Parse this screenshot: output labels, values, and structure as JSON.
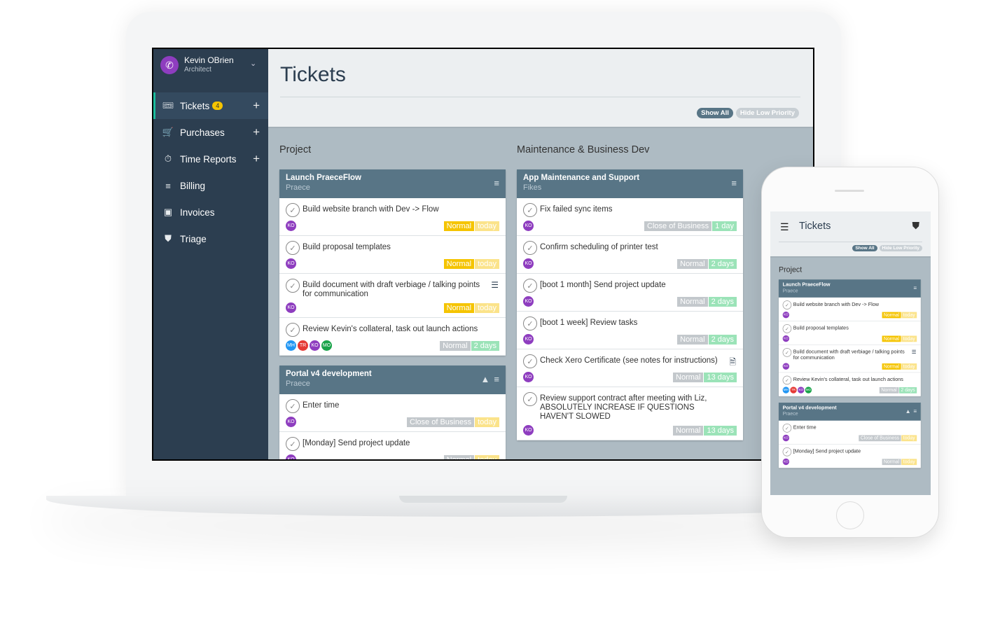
{
  "user": {
    "name": "Kevin OBrien",
    "role": "Architect"
  },
  "sidebar": {
    "items": [
      {
        "label": "Tickets",
        "icon": "ticket-icon",
        "glyph": "🎟",
        "badge": "4",
        "plus": true,
        "active": true
      },
      {
        "label": "Purchases",
        "icon": "cart-icon",
        "glyph": "🛒",
        "plus": true
      },
      {
        "label": "Time Reports",
        "icon": "stopwatch-icon",
        "glyph": "⏱",
        "plus": true
      },
      {
        "label": "Billing",
        "icon": "billing-list-icon",
        "glyph": "≡"
      },
      {
        "label": "Invoices",
        "icon": "inbox-icon",
        "glyph": "▣"
      },
      {
        "label": "Triage",
        "icon": "shield-icon",
        "glyph": "⛊"
      }
    ]
  },
  "header": {
    "title": "Tickets",
    "filters": {
      "show_all": "Show All",
      "hide_low": "Hide Low Priority"
    }
  },
  "colors": {
    "sidebar": "#2c3e50",
    "card_header": "#587586",
    "normal": "#f5c400",
    "today": "#fbe38a",
    "gray": "#c3c8cc",
    "days": "#9be3b8",
    "KO": "#8e3dbf",
    "MH": "#2196f3",
    "TR": "#e53935",
    "MO": "#1aa34a"
  },
  "columns": [
    {
      "title": "Project",
      "cards": [
        {
          "title": "Launch PraeceFlow",
          "subtitle": "Praece",
          "icons": [
            "menu-icon"
          ],
          "tickets": [
            {
              "title": "Build website branch with Dev -> Flow",
              "avatars": [
                "KO"
              ],
              "priority": {
                "label": "Normal",
                "color": "#f5c400"
              },
              "due": {
                "label": "today",
                "color": "#fbe38a"
              }
            },
            {
              "title": "Build proposal templates",
              "avatars": [
                "KO"
              ],
              "priority": {
                "label": "Normal",
                "color": "#f5c400"
              },
              "due": {
                "label": "today",
                "color": "#fbe38a"
              }
            },
            {
              "title": "Build document with draft verbiage / talking points for communication",
              "icon": "checklist-icon",
              "avatars": [
                "KO"
              ],
              "priority": {
                "label": "Normal",
                "color": "#f5c400"
              },
              "due": {
                "label": "today",
                "color": "#fbe38a"
              }
            },
            {
              "title": "Review Kevin's collateral, task out launch actions",
              "avatars": [
                "MH",
                "TR",
                "KO",
                "MO"
              ],
              "priority": {
                "label": "Normal",
                "color": "#c3c8cc"
              },
              "due": {
                "label": "2 days",
                "color": "#9be3b8"
              }
            }
          ]
        },
        {
          "title": "Portal v4 development",
          "subtitle": "Praece",
          "icons": [
            "google-drive-icon",
            "menu-icon"
          ],
          "tickets": [
            {
              "title": "Enter time",
              "avatars": [
                "KO"
              ],
              "priority": {
                "label": "Close of Business",
                "color": "#c3c8cc"
              },
              "due": {
                "label": "today",
                "color": "#fbe38a"
              }
            },
            {
              "title": "[Monday] Send project update",
              "avatars": [
                "KO"
              ],
              "priority": {
                "label": "Normal",
                "color": "#c3c8cc"
              },
              "due": {
                "label": "today",
                "color": "#fbe38a"
              }
            }
          ]
        }
      ]
    },
    {
      "title": "Maintenance & Business Dev",
      "cards": [
        {
          "title": "App Maintenance and Support",
          "subtitle": "Fikes",
          "icons": [
            "menu-icon"
          ],
          "tickets": [
            {
              "title": "Fix failed sync items",
              "avatars": [
                "KO"
              ],
              "priority": {
                "label": "Close of Business",
                "color": "#c3c8cc"
              },
              "due": {
                "label": "1 day",
                "color": "#9be3b8"
              }
            },
            {
              "title": "Confirm scheduling of printer test",
              "avatars": [
                "KO"
              ],
              "priority": {
                "label": "Normal",
                "color": "#c3c8cc"
              },
              "due": {
                "label": "2 days",
                "color": "#9be3b8"
              }
            },
            {
              "title": "[boot 1 month] Send project update",
              "avatars": [
                "KO"
              ],
              "priority": {
                "label": "Normal",
                "color": "#c3c8cc"
              },
              "due": {
                "label": "2 days",
                "color": "#9be3b8"
              }
            },
            {
              "title": "[boot 1 week] Review tasks",
              "avatars": [
                "KO"
              ],
              "priority": {
                "label": "Normal",
                "color": "#c3c8cc"
              },
              "due": {
                "label": "2 days",
                "color": "#9be3b8"
              }
            },
            {
              "title": "Check Xero Certificate (see notes for instructions)",
              "icon": "document-icon",
              "avatars": [
                "KO"
              ],
              "priority": {
                "label": "Normal",
                "color": "#c3c8cc"
              },
              "due": {
                "label": "13 days",
                "color": "#9be3b8"
              }
            },
            {
              "title": "Review support contract after meeting with Liz, ABSOLUTELY INCREASE IF QUESTIONS HAVEN'T SLOWED",
              "avatars": [
                "KO"
              ],
              "priority": {
                "label": "Normal",
                "color": "#c3c8cc"
              },
              "due": {
                "label": "13 days",
                "color": "#9be3b8"
              }
            }
          ]
        }
      ]
    }
  ]
}
